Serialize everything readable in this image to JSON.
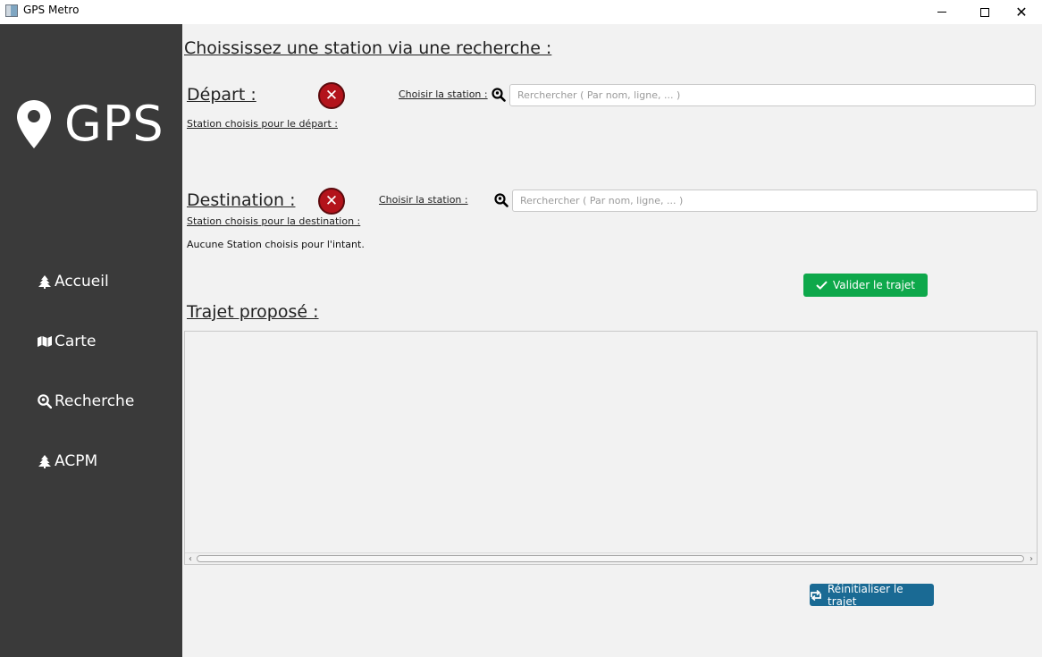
{
  "window": {
    "title": "GPS Metro",
    "icon": "app-window-icon",
    "controls": [
      "minimize-icon",
      "maximize-icon",
      "close-icon"
    ]
  },
  "sidebar": {
    "logo_icon": "map-marker-icon",
    "logo_text": "GPS",
    "items": [
      {
        "label": "Accueil",
        "icon": "tree-icon"
      },
      {
        "label": "Carte",
        "icon": "map-icon"
      },
      {
        "label": "Recherche",
        "icon": "search-location-icon"
      },
      {
        "label": "ACPM",
        "icon": "tree-icon"
      }
    ]
  },
  "main": {
    "heading": "Choississez une station via une recherche :",
    "depart": {
      "label": "Départ :",
      "status_icon": "error-icon",
      "choose_label": "Choisir la station :",
      "search_placeholder": "Rerchercher ( Par nom, ligne, ... )",
      "chosen_label": "Station choisis pour le départ :"
    },
    "destination": {
      "label": "Destination :",
      "status_icon": "error-icon",
      "choose_label": "Choisir la station :",
      "search_placeholder": "Rerchercher ( Par nom, ligne, ... )",
      "chosen_label": "Station choisis pour la destination :",
      "chosen_value": "Aucune Station choisis pour l'intant."
    },
    "validate_button": "Valider le trajet",
    "route_label": "Trajet proposé :",
    "reset_button": "Réinitialiser le trajet"
  },
  "colors": {
    "sidebar_bg": "#3a3a3a",
    "content_bg": "#f2f2f2",
    "validate_green": "#0ea84b",
    "reset_blue": "#1a6a94",
    "error_red": "#b3131b"
  }
}
